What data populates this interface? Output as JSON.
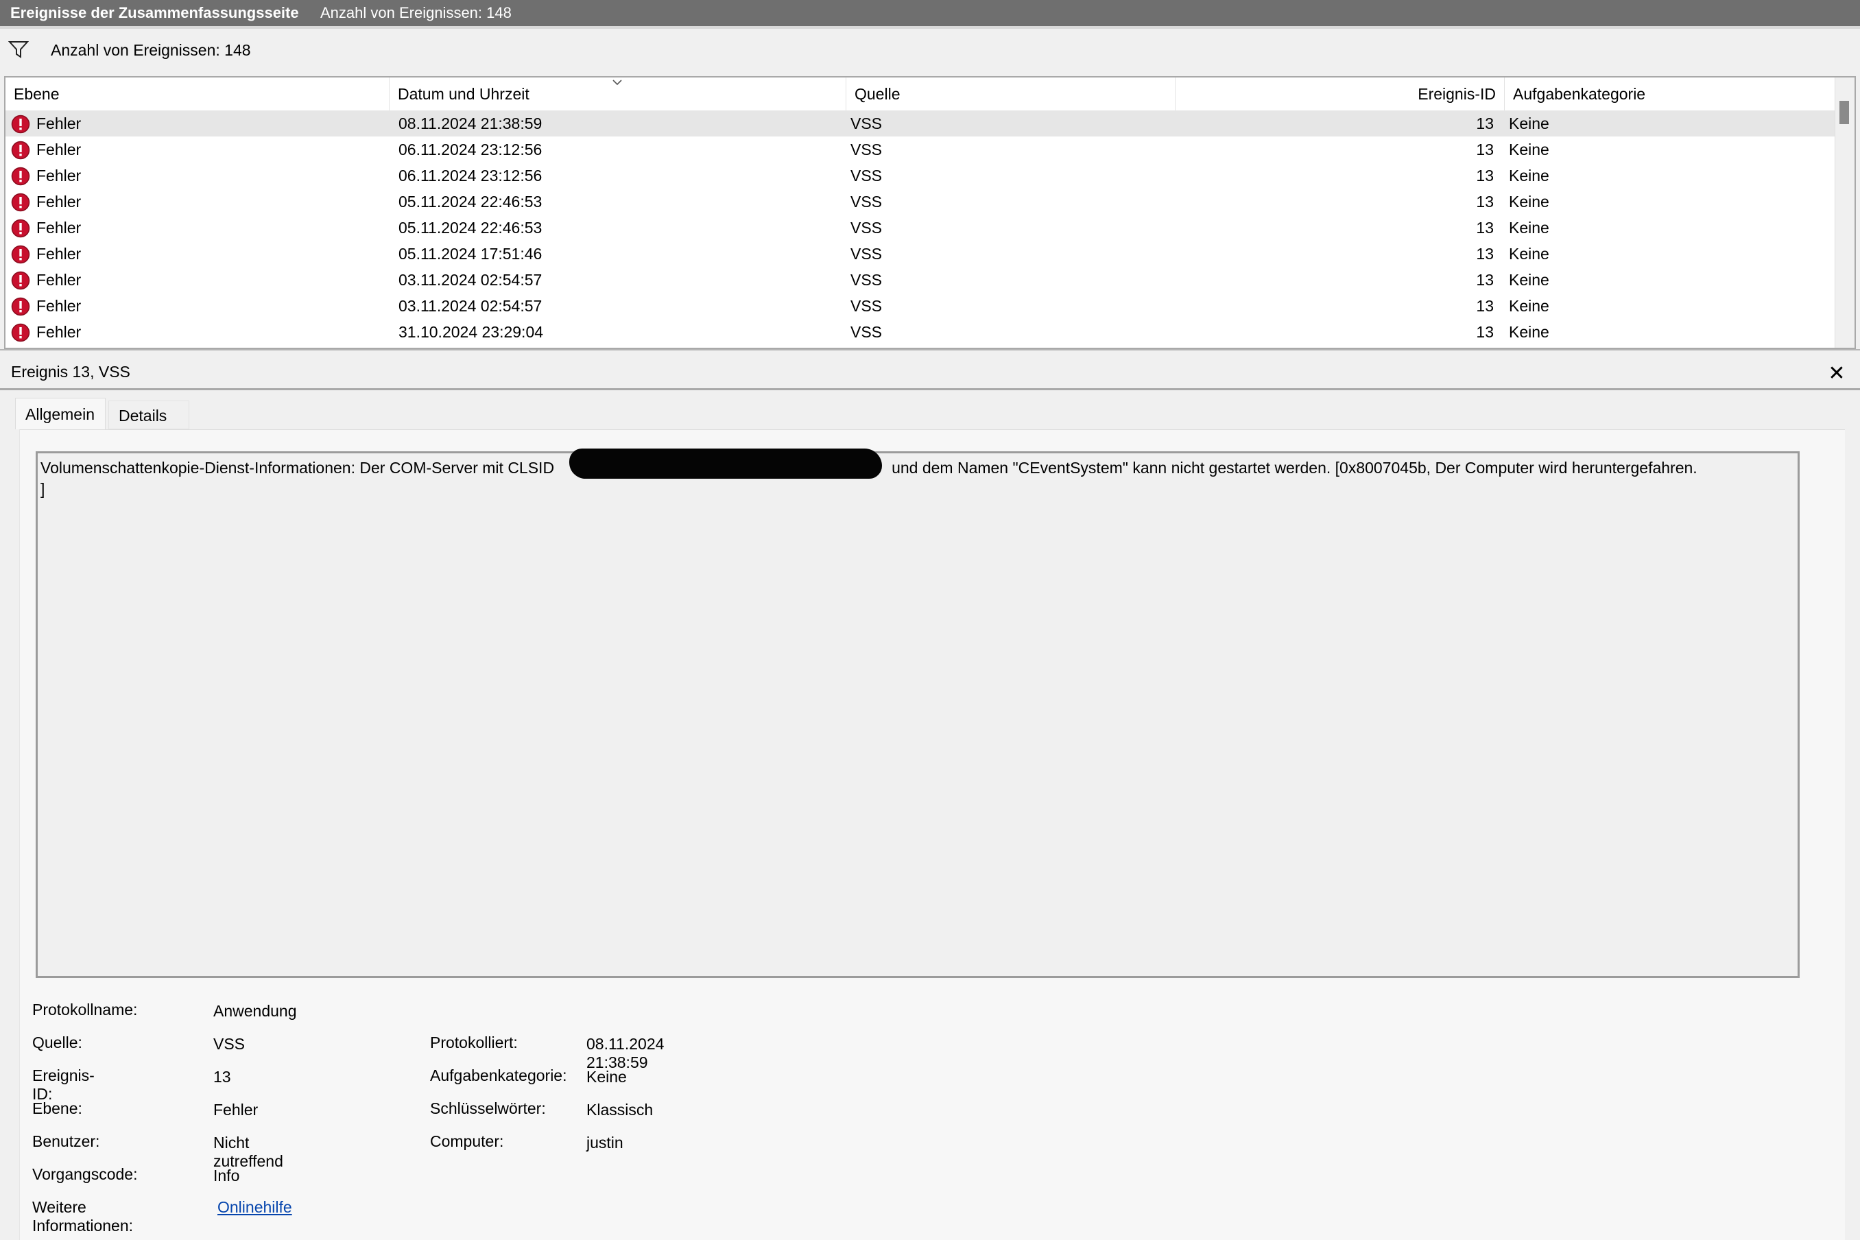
{
  "titlebar": {
    "title": "Ereignisse der Zusammenfassungsseite",
    "count": "Anzahl von Ereignissen: 148"
  },
  "filterbar": {
    "count": "Anzahl von Ereignissen: 148",
    "icon": "filter-icon"
  },
  "list": {
    "columns": [
      "Ebene",
      "Datum und Uhrzeit",
      "Quelle",
      "Ereignis-ID",
      "Aufgabenkategorie"
    ],
    "rows": [
      {
        "level": "Fehler",
        "date": "08.11.2024 21:38:59",
        "source": "VSS",
        "id": "13",
        "task": "Keine"
      },
      {
        "level": "Fehler",
        "date": "06.11.2024 23:12:56",
        "source": "VSS",
        "id": "13",
        "task": "Keine"
      },
      {
        "level": "Fehler",
        "date": "06.11.2024 23:12:56",
        "source": "VSS",
        "id": "13",
        "task": "Keine"
      },
      {
        "level": "Fehler",
        "date": "05.11.2024 22:46:53",
        "source": "VSS",
        "id": "13",
        "task": "Keine"
      },
      {
        "level": "Fehler",
        "date": "05.11.2024 22:46:53",
        "source": "VSS",
        "id": "13",
        "task": "Keine"
      },
      {
        "level": "Fehler",
        "date": "05.11.2024 17:51:46",
        "source": "VSS",
        "id": "13",
        "task": "Keine"
      },
      {
        "level": "Fehler",
        "date": "03.11.2024 02:54:57",
        "source": "VSS",
        "id": "13",
        "task": "Keine"
      },
      {
        "level": "Fehler",
        "date": "03.11.2024 02:54:57",
        "source": "VSS",
        "id": "13",
        "task": "Keine"
      },
      {
        "level": "Fehler",
        "date": "31.10.2024 23:29:04",
        "source": "VSS",
        "id": "13",
        "task": "Keine"
      }
    ],
    "level_icon": "error-icon"
  },
  "detail": {
    "title": "Ereignis 13, VSS",
    "tabs": [
      "Allgemein",
      "Details"
    ],
    "message_before": "Volumenschattenkopie-Dienst-Informationen: Der COM-Server mit CLSID",
    "message_after": "und dem Namen \"CEventSystem\" kann nicht gestartet werden. [0x8007045b, Der Computer wird heruntergefahren.",
    "message_end": "]",
    "props": {
      "protokollname_label": "Protokollname:",
      "protokollname": "Anwendung",
      "quelle_label": "Quelle:",
      "quelle": "VSS",
      "ereignis_id_label": "Ereignis-ID:",
      "ereignis_id": "13",
      "ebene_label": "Ebene:",
      "ebene": "Fehler",
      "benutzer_label": "Benutzer:",
      "benutzer": "Nicht zutreffend",
      "vorgangscode_label": "Vorgangscode:",
      "vorgangscode": "Info",
      "weitere_label": "Weitere Informationen:",
      "weitere_link": "Onlinehilfe",
      "protokolliert_label": "Protokolliert:",
      "protokolliert": "08.11.2024 21:38:59",
      "aufgabenkategorie_label": "Aufgabenkategorie:",
      "aufgabenkategorie": "Keine",
      "schluesselwoerter_label": "Schlüsselwörter:",
      "schluesselwoerter": "Klassisch",
      "computer_label": "Computer:",
      "computer": "justin"
    }
  },
  "colors": {
    "titlebar_bg": "#6f6f6f",
    "error_red": "#c8102e",
    "link": "#0645ad"
  }
}
